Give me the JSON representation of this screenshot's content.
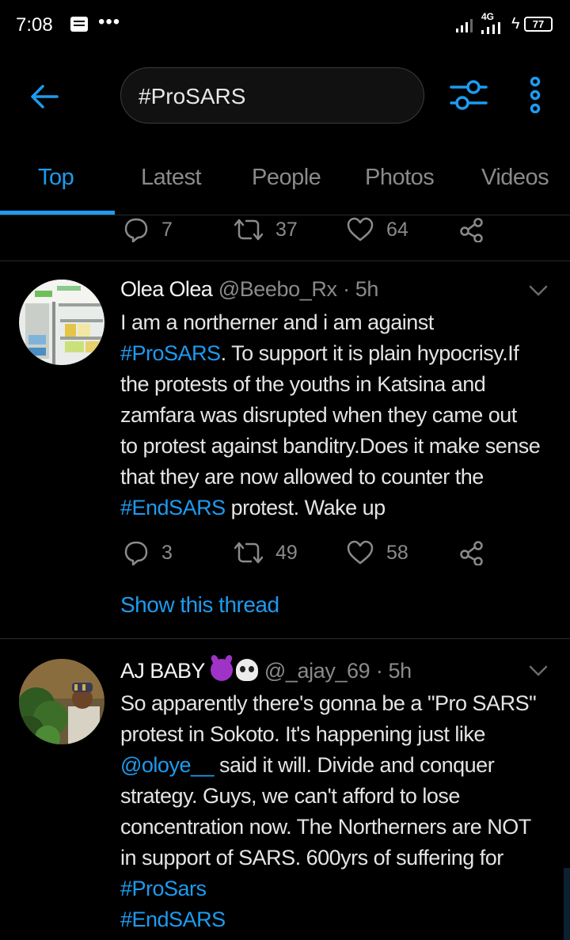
{
  "status_bar": {
    "time": "7:08",
    "dots": "•••",
    "network": "4G",
    "battery": "77"
  },
  "search": {
    "query": "#ProSARS"
  },
  "tabs": [
    {
      "label": "Top",
      "active": true
    },
    {
      "label": "Latest",
      "active": false
    },
    {
      "label": "People",
      "active": false
    },
    {
      "label": "Photos",
      "active": false
    },
    {
      "label": "Videos",
      "active": false
    }
  ],
  "prev_tweet_actions": {
    "replies": "7",
    "retweets": "37",
    "likes": "64"
  },
  "tweets": [
    {
      "name": "Olea Olea",
      "handle": "@Beebo_Rx",
      "time": "· 5h",
      "lines": [
        [
          {
            "t": "I am a northerner and i am against"
          }
        ],
        [
          {
            "t": "#ProSARS",
            "link": true
          },
          {
            "t": ". To support it is plain hypocrisy.If"
          }
        ],
        [
          {
            "t": "the protests of the  youths in Katsina and"
          }
        ],
        [
          {
            "t": "zamfara  was disrupted  when they came out"
          }
        ],
        [
          {
            "t": "to protest against banditry.Does it make sense"
          }
        ],
        [
          {
            "t": "that they are now allowed to counter the"
          }
        ],
        [
          {
            "t": "#EndSARS",
            "link": true
          },
          {
            "t": " protest. Wake up"
          }
        ]
      ],
      "replies": "3",
      "retweets": "49",
      "likes": "58",
      "thread_link": "Show this thread"
    },
    {
      "name": "AJ BABY",
      "handle": "@_ajay_69",
      "time": "· 5h",
      "lines": [
        [
          {
            "t": "So apparently there's gonna be a \"Pro SARS\""
          }
        ],
        [
          {
            "t": "protest in Sokoto. It's happening just like"
          }
        ],
        [
          {
            "t": "@oloye__",
            "link": true
          },
          {
            "t": " said it will. Divide and conquer"
          }
        ],
        [
          {
            "t": "strategy. Guys, we can't afford to lose"
          }
        ],
        [
          {
            "t": "concentration now. The Northerners are NOT"
          }
        ],
        [
          {
            "t": "in support of SARS. 600yrs of suffering for"
          }
        ],
        [
          {
            "t": "#ProSars",
            "link": true
          }
        ],
        [
          {
            "t": "#EndSARS",
            "link": true
          }
        ]
      ]
    }
  ],
  "colors": {
    "accent": "#1d9bf0",
    "background": "#000000",
    "muted": "#8a8a8a"
  },
  "icons": [
    "back-arrow-icon",
    "filter-icon",
    "more-vertical-icon",
    "reply-icon",
    "retweet-icon",
    "like-icon",
    "share-icon",
    "caret-down-icon"
  ]
}
